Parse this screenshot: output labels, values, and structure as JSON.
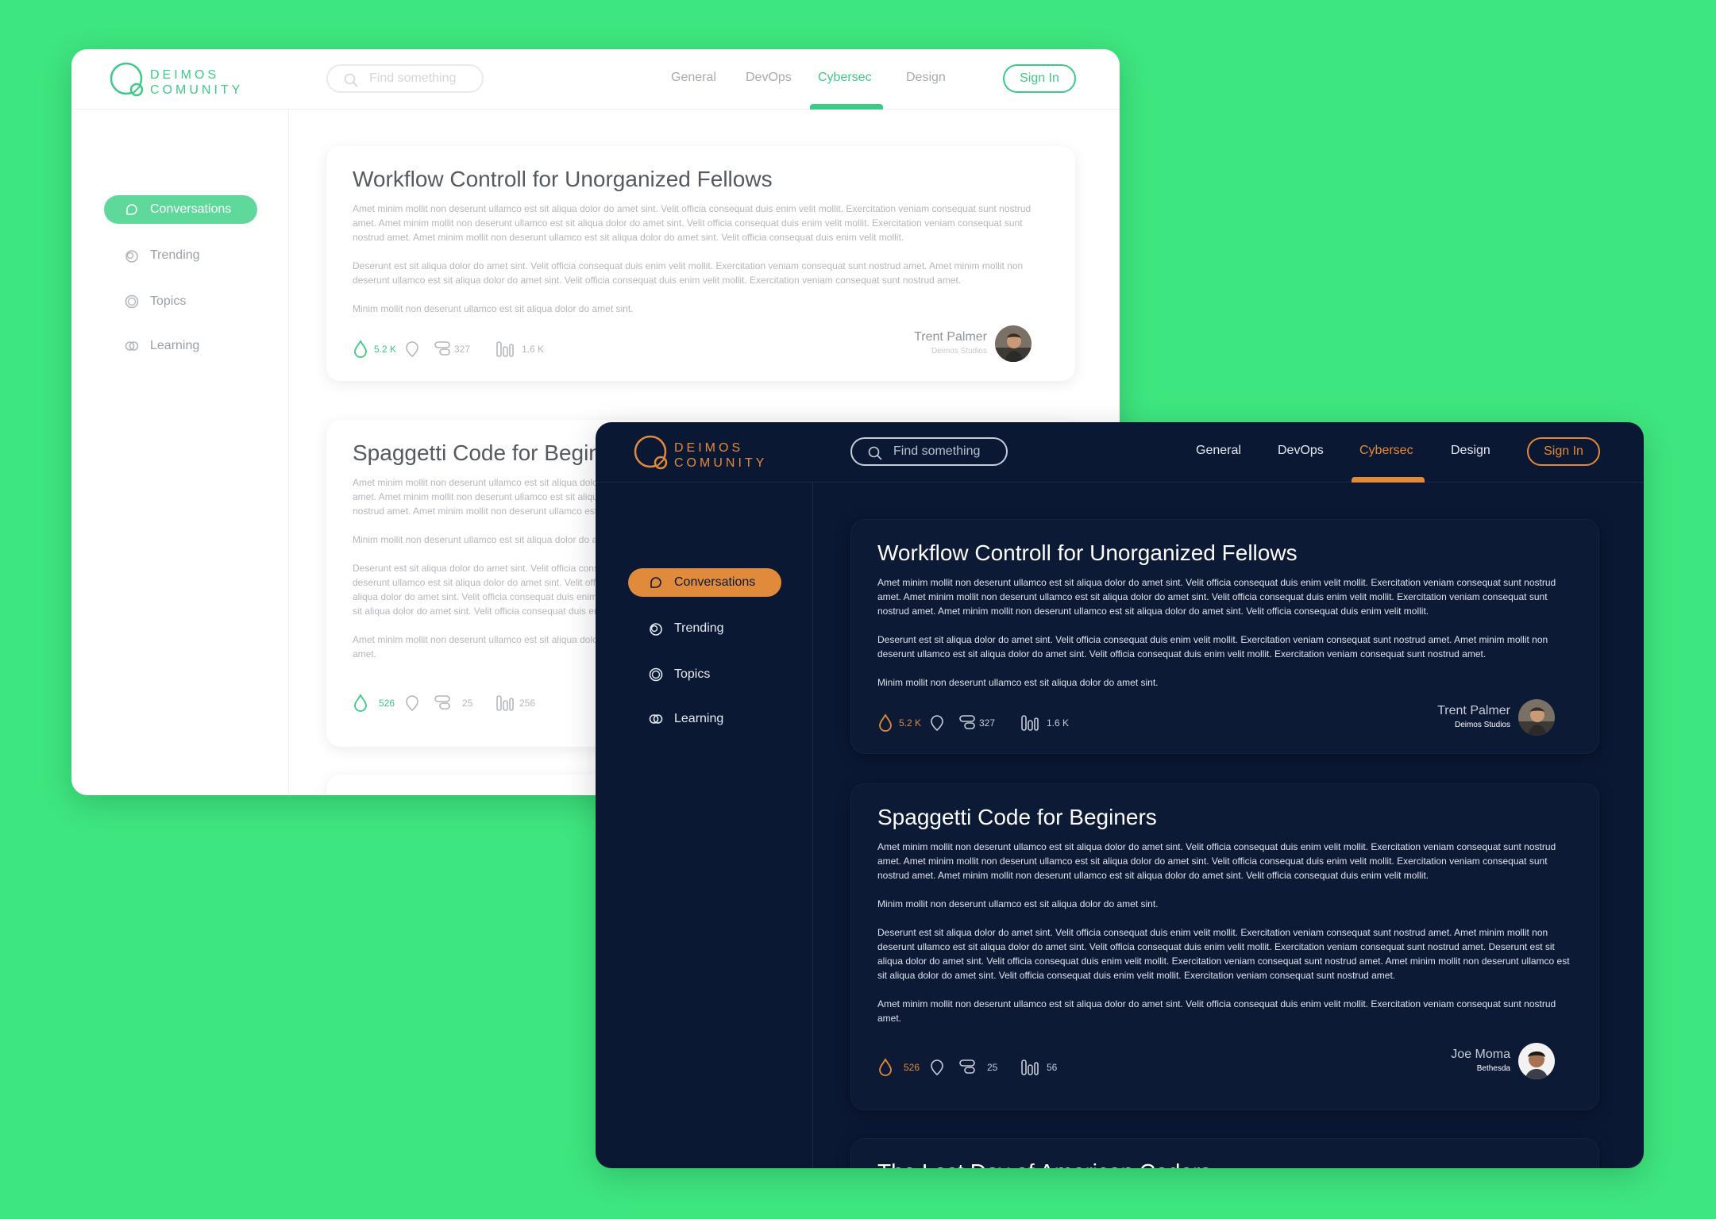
{
  "brand": {
    "name": "DEIMOS\nCOMUNITY",
    "light_accent": "#3ec987",
    "dark_accent": "#e38a3a",
    "background": "#3ee67f"
  },
  "search": {
    "placeholder": "Find something"
  },
  "nav": {
    "items": [
      "General",
      "DevOps",
      "Cybersec",
      "Design"
    ],
    "active": "Cybersec"
  },
  "signin_label": "Sign In",
  "sidebar": {
    "items": [
      {
        "label": "Conversations",
        "icon": "chat-bubble-icon",
        "active": true
      },
      {
        "label": "Trending",
        "icon": "trending-icon",
        "active": false
      },
      {
        "label": "Topics",
        "icon": "topics-icon",
        "active": false
      },
      {
        "label": "Learning",
        "icon": "learning-icon",
        "active": false
      }
    ]
  },
  "posts": [
    {
      "title": "Workflow Controll for Unorganized Fellows",
      "paragraphs": [
        "Amet minim mollit non deserunt ullamco est sit aliqua dolor do amet sint. Velit officia consequat duis enim velit mollit. Exercitation veniam consequat sunt nostrud amet. Amet minim mollit non deserunt ullamco est sit aliqua dolor do amet sint. Velit officia consequat duis enim velit mollit. Exercitation veniam consequat sunt nostrud amet. Amet minim mollit non deserunt ullamco est sit aliqua dolor do amet sint. Velit officia consequat duis enim velit mollit.",
        "Deserunt  est sit aliqua dolor do amet sint. Velit officia consequat duis enim velit mollit. Exercitation veniam consequat sunt nostrud amet. Amet minim mollit non deserunt ullamco est sit aliqua dolor do amet sint. Velit officia consequat duis enim velit mollit. Exercitation veniam consequat sunt nostrud amet.",
        "Minim mollit non deserunt ullamco est sit aliqua dolor do amet sint."
      ],
      "likes": "5.2 K",
      "comments": "327",
      "views": "1.6 K",
      "author": "Trent Palmer",
      "org": "Deimos Studios"
    },
    {
      "title": "Spaggetti Code for Beginers",
      "paragraphs": [
        "Amet minim mollit non deserunt ullamco est sit aliqua dolor do amet sint. Velit officia consequat duis enim velit mollit. Exercitation veniam consequat sunt nostrud amet. Amet minim mollit non deserunt ullamco est sit aliqua dolor do amet sint. Velit officia consequat duis enim velit mollit. Exercitation veniam consequat sunt nostrud amet. Amet minim mollit non deserunt ullamco est sit aliqua dolor do amet sint. Velit officia consequat duis enim velit mollit.",
        "Minim mollit non deserunt ullamco est sit aliqua dolor do amet sint.",
        "Deserunt  est sit aliqua dolor do amet sint. Velit officia consequat duis enim velit mollit. Exercitation veniam consequat sunt nostrud amet. Amet minim mollit non deserunt ullamco est sit aliqua dolor do amet sint. Velit officia consequat duis enim velit mollit. Exercitation veniam consequat sunt nostrud amet. Deserunt  est sit aliqua dolor do amet sint. Velit officia consequat duis enim velit mollit. Exercitation veniam consequat sunt nostrud amet. Amet minim mollit non deserunt ullamco est sit aliqua dolor do amet sint. Velit officia consequat duis enim velit mollit. Exercitation veniam consequat sunt nostrud amet.",
        " Amet minim mollit non deserunt ullamco est sit aliqua dolor do amet sint. Velit officia consequat duis enim velit mollit. Exercitation veniam consequat sunt nostrud amet."
      ],
      "likes": "526",
      "comments": "25",
      "views_light": "256",
      "views_dark": "56",
      "author": "Joe Moma",
      "org": "Bethesda"
    },
    {
      "title": "The Last Day of American Coders"
    }
  ]
}
